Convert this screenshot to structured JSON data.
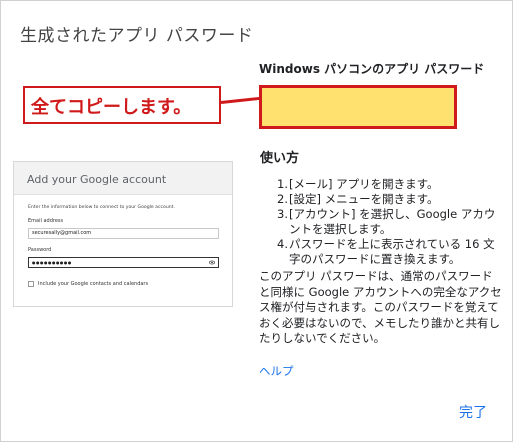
{
  "dialog": {
    "title": "生成されたアプリ パスワード",
    "password_heading": "Windows パソコンのアプリ パスワード",
    "callout_text": "全てコピーします。",
    "usage_heading": "使い方",
    "steps": [
      {
        "num": "1.",
        "text": "[メール] アプリを開きます。"
      },
      {
        "num": "2.",
        "text": "[設定] メニューを開きます。"
      },
      {
        "num": "3.",
        "text": "[アカウント] を選択し、Google アカウントを選択します。"
      },
      {
        "num": "4.",
        "text": "パスワードを上に表示されている 16 文字のパスワードに置き換えます。"
      }
    ],
    "description": "このアプリ パスワードは、通常のパスワードと同様に Google アカウントへの完全なアクセス権が付与されます。このパスワードを覚えておく必要はないので、メモしたり誰かと共有したりしないでください。",
    "help_link": "ヘルプ",
    "done_button": "完了",
    "colors": {
      "highlight": "#fee16e",
      "callout_red": "#d0191b",
      "link_blue": "#1a73e8"
    }
  },
  "google_card": {
    "title": "Add your Google account",
    "instruction": "Enter the information below to connect to your Google account.",
    "email_label": "Email address",
    "email_value": "securesally@gmail.com",
    "password_label": "Password",
    "password_value": "●●●●●●●●●●",
    "checkbox_label": "Include your Google contacts and calendars",
    "eye_icon": "eye-icon"
  }
}
